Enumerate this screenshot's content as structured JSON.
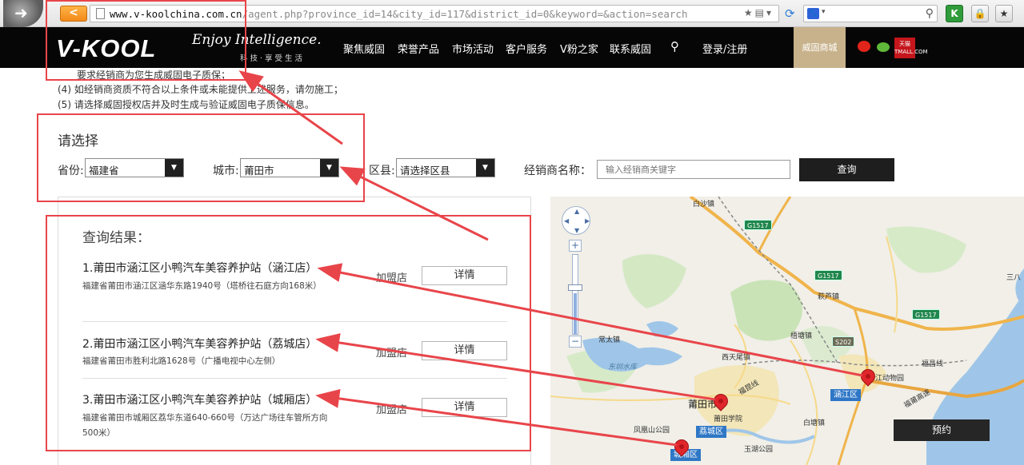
{
  "browser": {
    "back_label": "<",
    "url_host": "www.v-koolchina.com.cn",
    "url_path": "/agent.php?province_id=14&city_id=117&district_id=0&keyword=&action=search",
    "search_caret": "▾",
    "ext_k": "K"
  },
  "nav": {
    "brand": "V-KOOL",
    "slogan": "Enjoy Intelligence.",
    "slogan_cn": "科技·享受生活",
    "menu": [
      "聚焦威固",
      "荣誉产品",
      "市场活动",
      "客户服务",
      "V粉之家",
      "联系威固"
    ],
    "login": "登录/注册",
    "mall": "威固商城",
    "tmall": "天猫 TMALL.COM"
  },
  "notes": [
    "要求经销商为您生成威固电子质保；",
    "(4) 如经销商资质不符合以上条件或未能提供上述服务，请勿施工；",
    "(5) 请选择威固授权店并及时生成与验证威固电子质保信息。"
  ],
  "form": {
    "heading": "请选择",
    "province_label": "省份:",
    "province_value": "福建省",
    "city_label": "城市:",
    "city_value": "莆田市",
    "district_label": "区县:",
    "district_value": "请选择区县",
    "keyword_label": "经销商名称：",
    "keyword_placeholder": "输入经销商关键字",
    "query_button": "查询"
  },
  "results": {
    "title": "查询结果：",
    "items": [
      {
        "name": "1.莆田市涵江区小鸭汽车美容养护站（涵江店）",
        "address": "福建省莆田市涵江区涵华东路1940号（塔桥往石庭方向168米）",
        "type": "加盟店",
        "button": "详情"
      },
      {
        "name": "2.莆田市涵江区小鸭汽车美容养护站（荔城店）",
        "address": "福建省莆田市胜利北路1628号（广播电视中心左侧）",
        "type": "加盟店",
        "button": "详情"
      },
      {
        "name": "3.莆田市涵江区小鸭汽车美容养护站（城厢店）",
        "address": "福建省莆田市城厢区荔华东道640-660号（万达广场往车管所方向500米）",
        "type": "加盟店",
        "button": "详情"
      }
    ]
  },
  "map": {
    "labels": {
      "baisha": "白沙镇",
      "qiulu": "萩芦镇",
      "wutang": "梧塘镇",
      "changtai": "常太镇",
      "donghu": "东圳水库",
      "xitian": "西天尾镇",
      "putian": "莆田市",
      "putian_college": "莆田学院",
      "fenghuang": "凤凰山公园",
      "baitang": "白塘镇",
      "zoo": "江动物园",
      "yuhu": "玉湖公园",
      "fuqing": "福昆线",
      "fuchang": "福昌线",
      "sanba": "三八",
      "expressway": "福莆高速"
    },
    "shields": [
      "G1517",
      "G1517",
      "G1517",
      "S202"
    ],
    "districts": [
      "涵江区",
      "荔城区",
      "城厢区"
    ],
    "reserve_button": "预约",
    "zoom_in": "+",
    "zoom_out": "−"
  }
}
